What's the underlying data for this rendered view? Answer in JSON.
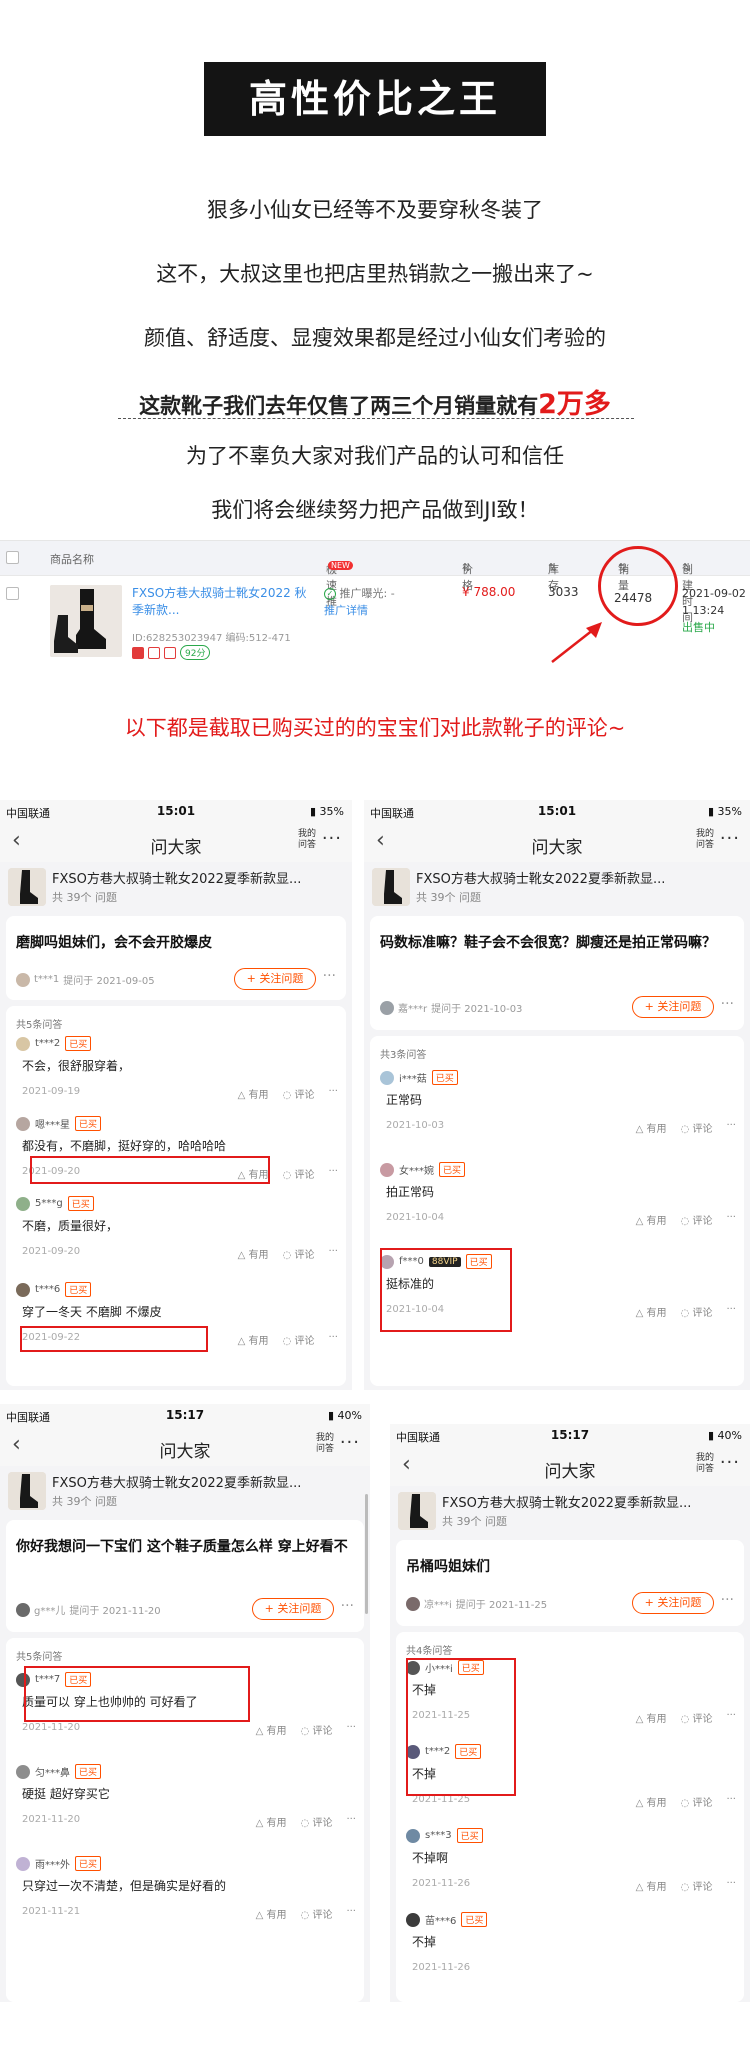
{
  "header": {
    "title": "高性价比之王"
  },
  "intro": {
    "lines": [
      "狠多小仙女已经等不及要穿秋冬装了",
      "这不，大叔这里也把店里热销款之一搬出来了~",
      "颜值、舒适度、显瘦效果都是经过小仙女们考验的"
    ],
    "sales_line_prefix": "这款靴子我们去年仅售了两三个月销量就有",
    "sales_highlight": "2万多",
    "line5": "为了不辜负大家对我们产品的认可和信任",
    "line6": "我们将会继续努力把产品做到JI致！"
  },
  "product_table": {
    "headers": {
      "name": "商品名称",
      "promo": "极速推",
      "promo_badge": "NEW",
      "price": "价格",
      "stock": "库存",
      "sales": "销量",
      "created": "创建时间"
    },
    "row": {
      "name": "FXSO方巷大叔骑士靴女2022 秋季新款...",
      "id_line": "ID:628253023947 编码:512-471",
      "score": "92分",
      "promo_line1": "推广曝光: -",
      "promo_line2": "推广详情",
      "price": "¥ 788.00",
      "stock": "3033",
      "sales": "24478",
      "created_date": "2021-09-02",
      "created_time": "1 13:24",
      "status": "出售中"
    }
  },
  "red_note": "以下都是截取已购买过的的宝宝们对此款靴子的评论~",
  "phones": [
    {
      "carrier": "中国联通",
      "time": "15:01",
      "battery": "35%",
      "nav_title": "问大家",
      "my_q": "我的问答",
      "product_name": "FXSO方巷大叔骑士靴女2022夏季新款显...",
      "question_count": "共 39个 问题",
      "question": "磨脚吗姐妹们，会不会开胶爆皮",
      "asker": "t***1",
      "ask_date": "提问于 2021-09-05",
      "follow": "+ 关注问题",
      "answer_count": "共5条问答",
      "answers": [
        {
          "user": "t***2",
          "badge": "已买",
          "text": "不会，很舒服穿着，",
          "date": "2021-09-19"
        },
        {
          "user": "嗯***星",
          "badge": "已买",
          "text": "都没有，不磨脚，挺好穿的，哈哈哈哈",
          "date": "2021-09-20"
        },
        {
          "user": "5***g",
          "badge": "已买",
          "text": "不磨，质量很好，",
          "date": "2021-09-20"
        },
        {
          "user": "t***6",
          "badge": "已买",
          "text": "穿了一冬天  不磨脚  不爆皮",
          "date": "2021-09-22"
        }
      ],
      "useful": "有用",
      "comment": "评论"
    },
    {
      "carrier": "中国联通",
      "time": "15:01",
      "battery": "35%",
      "nav_title": "问大家",
      "my_q": "我的问答",
      "product_name": "FXSO方巷大叔骑士靴女2022夏季新款显...",
      "question_count": "共 39个 问题",
      "question": "码数标准嘛？鞋子会不会很宽？脚瘦还是拍正常码嘛？",
      "asker": "嘉***r",
      "ask_date": "提问于 2021-10-03",
      "follow": "+ 关注问题",
      "answer_count": "共3条问答",
      "answers": [
        {
          "user": "i***菇",
          "badge": "已买",
          "text": "正常码",
          "date": "2021-10-03"
        },
        {
          "user": "女***婉",
          "badge": "已买",
          "text": "拍正常码",
          "date": "2021-10-04"
        },
        {
          "user": "f***0",
          "vip": "88VIP",
          "badge": "已买",
          "text": "挺标准的",
          "date": "2021-10-04"
        }
      ],
      "useful": "有用",
      "comment": "评论"
    },
    {
      "carrier": "中国联通",
      "time": "15:17",
      "battery": "40%",
      "nav_title": "问大家",
      "my_q": "我的问答",
      "product_name": "FXSO方巷大叔骑士靴女2022夏季新款显...",
      "question_count": "共 39个 问题",
      "question": "你好我想问一下宝们 这个鞋子质量怎么样 穿上好看不",
      "asker": "g***儿",
      "ask_date": "提问于 2021-11-20",
      "follow": "+ 关注问题",
      "answer_count": "共5条问答",
      "answers": [
        {
          "user": "t***7",
          "badge": "已买",
          "text": "质量可以 穿上也帅帅的 可好看了",
          "date": "2021-11-20"
        },
        {
          "user": "匀***鼻",
          "badge": "已买",
          "text": "硬挺 超好穿买它",
          "date": "2021-11-20"
        },
        {
          "user": "雨***外",
          "badge": "已买",
          "text": "只穿过一次不清楚，但是确实是好看的",
          "date": "2021-11-21"
        }
      ],
      "useful": "有用",
      "comment": "评论"
    },
    {
      "carrier": "中国联通",
      "time": "15:17",
      "battery": "40%",
      "nav_title": "问大家",
      "my_q": "我的问答",
      "product_name": "FXSO方巷大叔骑士靴女2022夏季新款显...",
      "question_count": "共 39个 问题",
      "question": "吊桶吗姐妹们",
      "asker": "凉***i",
      "ask_date": "提问于 2021-11-25",
      "follow": "+ 关注问题",
      "answer_count": "共4条问答",
      "answers": [
        {
          "user": "小***i",
          "badge": "已买",
          "text": "不掉",
          "date": "2021-11-25"
        },
        {
          "user": "t***2",
          "badge": "已买",
          "text": "不掉",
          "date": "2021-11-25"
        },
        {
          "user": "s***3",
          "badge": "已买",
          "text": "不掉啊",
          "date": "2021-11-26"
        },
        {
          "user": "苗***6",
          "badge": "已买",
          "text": "不掉",
          "date": "2021-11-26"
        }
      ],
      "useful": "有用",
      "comment": "评论"
    }
  ]
}
